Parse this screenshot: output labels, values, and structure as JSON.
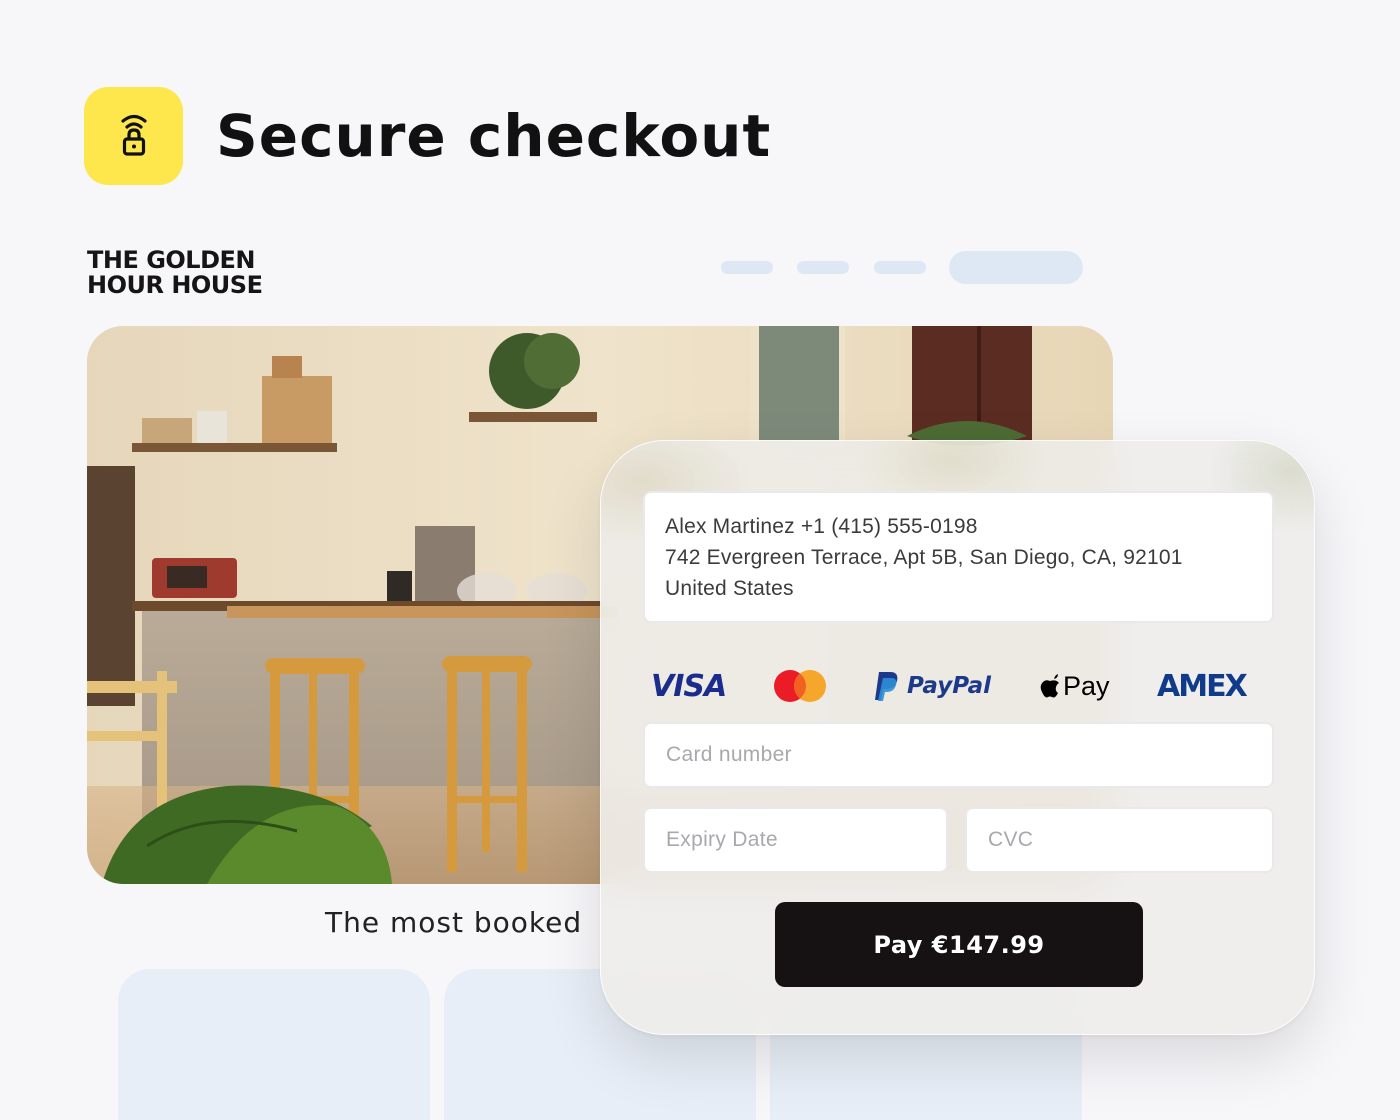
{
  "header": {
    "title": "Secure checkout",
    "icon": "lock-wifi-icon",
    "badge_color": "#fde74c"
  },
  "site": {
    "brand_line1": "THE GOLDEN",
    "brand_line2": "HOUR HOUSE",
    "tagline": "The most booked"
  },
  "checkout": {
    "address": {
      "line1": "Alex Martinez +1 (415) 555-0198",
      "line2": "742 Evergreen Terrace, Apt 5B, San Diego, CA, 92101",
      "line3": "United States"
    },
    "payment_methods": [
      {
        "name": "VISA",
        "icon": "visa-logo"
      },
      {
        "name": "Mastercard",
        "icon": "mastercard-logo"
      },
      {
        "name": "PayPal",
        "icon": "paypal-logo"
      },
      {
        "name": "Pay",
        "icon": "apple-pay-logo"
      },
      {
        "name": "AMEX",
        "icon": "amex-logo"
      }
    ],
    "card_number_placeholder": "Card number",
    "expiry_placeholder": "Expiry Date",
    "cvc_placeholder": "CVC",
    "pay_button": "Pay €147.99",
    "button_color": "#161214"
  }
}
